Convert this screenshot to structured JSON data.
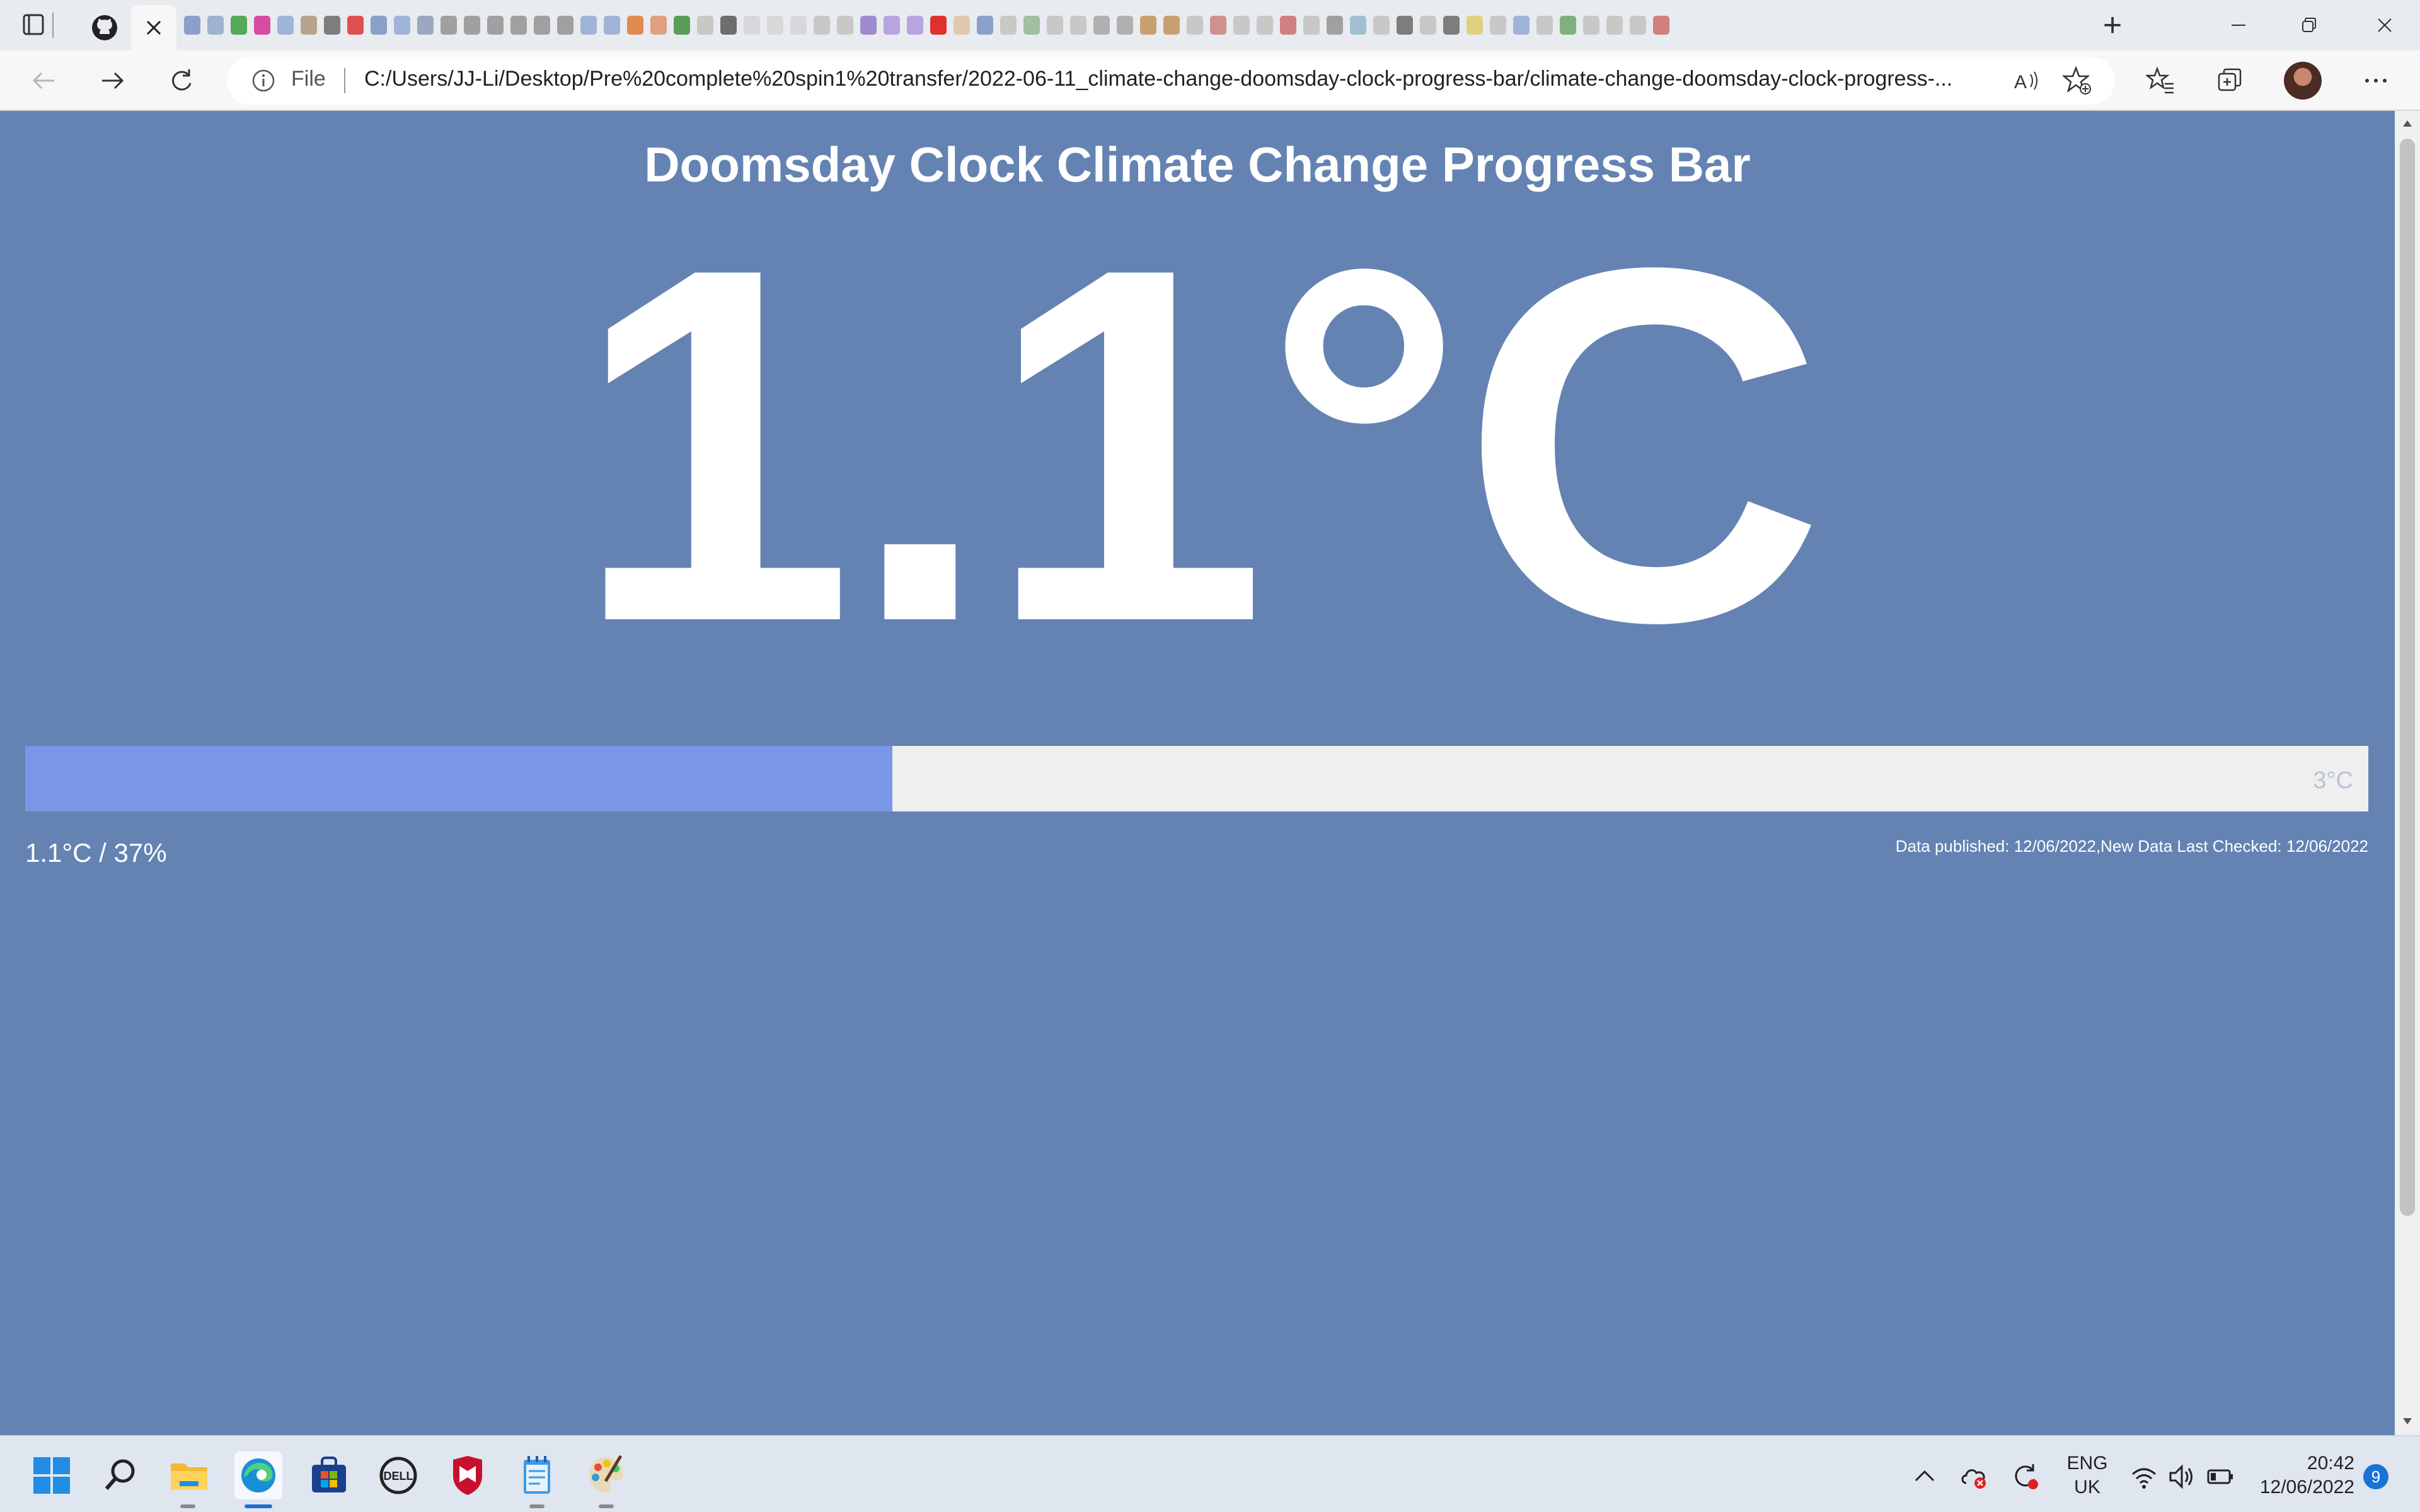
{
  "browser": {
    "active_tab": {
      "close_label": "×"
    },
    "new_tab_label": "+",
    "mini_tab_colors": [
      "#8aa0c8",
      "#9fb2d0",
      "#56a85a",
      "#d94aa3",
      "#a0b4d8",
      "#b7a48a",
      "#7d7d7d",
      "#e05050",
      "#8aa0c8",
      "#a0b4d8",
      "#9aa8c0",
      "#a0a0a0",
      "#a0a0a0",
      "#a0a0a0",
      "#a0a0a0",
      "#a0a0a0",
      "#a0a0a0",
      "#a0b4d8",
      "#a0b4d8",
      "#e08a50",
      "#e0a080",
      "#5a9c5a",
      "#c8c8c8",
      "#6e6e6e",
      "#d8d8d8",
      "#d8d8d8",
      "#d8d8d8",
      "#c8c8c8",
      "#c8c8c8",
      "#9f8ad0",
      "#b7a4e0",
      "#b7a4e0",
      "#e03030",
      "#e0c8b0",
      "#8aa0c8",
      "#c8c8c8",
      "#a0c0a0",
      "#c8c8c8",
      "#c8c8c8",
      "#b0b0b0",
      "#b0b0b0",
      "#c8a070",
      "#c8a070",
      "#c8c8c8",
      "#d09090",
      "#c8c8c8",
      "#c8c8c8",
      "#d08080",
      "#c8c8c8",
      "#a0a0a0",
      "#a0c0d0",
      "#c8c8c8",
      "#7d7d7d",
      "#c8c8c8",
      "#7d7d7d",
      "#e0d080",
      "#c8c8c8",
      "#a0b4d8",
      "#c8c8c8",
      "#80b080",
      "#c8c8c8",
      "#c8c8c8",
      "#c8c8c8",
      "#d08080"
    ],
    "address": {
      "file_label": "File",
      "url": "C:/Users/JJ-Li/Desktop/Pre%20complete%20spin1%20transfer/2022-06-11_climate-change-doomsday-clock-progress-bar/climate-change-doomsday-clock-progress-..."
    }
  },
  "page": {
    "title": "Doomsday Clock Climate Change Progress Bar",
    "big_temperature": "1.1°C",
    "progress": {
      "value_percent": 37,
      "max_label": "3°C",
      "fill_color": "#7a96e6",
      "track_color": "#efefef"
    },
    "reading_label": "1.1°C / 37%",
    "published_label": "Data published: 12/06/2022,New Data Last Checked: 12/06/2022",
    "background_color": "#6483b3"
  },
  "taskbar": {
    "apps": [
      "start-icon",
      "search-icon",
      "file-explorer-icon",
      "edge-icon",
      "store-icon",
      "dell-icon",
      "mcafee-icon",
      "notepad-icon",
      "paint-icon"
    ],
    "language": {
      "line1": "ENG",
      "line2": "UK"
    },
    "clock": {
      "time": "20:42",
      "date": "12/06/2022"
    },
    "notification_count": "9"
  }
}
